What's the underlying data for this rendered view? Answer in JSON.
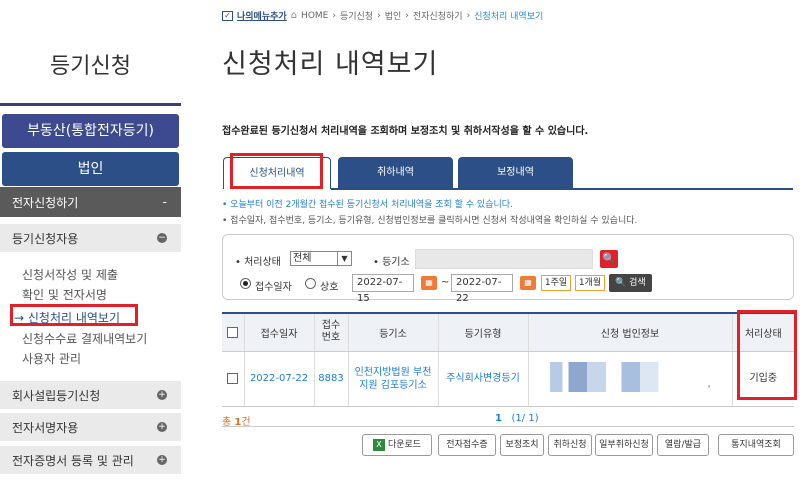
{
  "sidebar": {
    "title": "등기신청",
    "realestate_btn": "부동산(통합전자등기)",
    "corp_btn": "법인",
    "ecert": {
      "label": "전자신청하기",
      "ctl": "-"
    },
    "reguse": {
      "label": "등기신청자용"
    },
    "subitems": [
      "신청서작성 및 제출",
      "확인 및 전자서명",
      "→ 신청처리 내역보기",
      "신청수수료 결제내역보기",
      "사용자 관리"
    ],
    "sections": [
      "회사설립등기신청",
      "전자서명자용",
      "전자증명서 등록 및 관리"
    ]
  },
  "breadcrumb": {
    "mymenu": "나의메뉴추가",
    "items": [
      "HOME",
      "등기신청",
      "법인",
      "전자신청하기"
    ],
    "current": "신청처리 내역보기"
  },
  "page_title": "신청처리 내역보기",
  "description": "접수완료된 등기신청서 처리내역을 조회하며 보정조치 및 취하서작성을 할 수 있습니다.",
  "tabs": [
    "신청처리내역",
    "취하내역",
    "보정내역"
  ],
  "notes": {
    "line1": "오늘부터 이전 2개월간 접수된 등기신청서 처리내역을 조회 할 수 있습니다.",
    "line2": "접수일자, 접수번호, 등기소, 등기유형, 신청법인정보를 클릭하시면 신청서 작성내역을 확인하실 수 있습니다."
  },
  "search": {
    "status_label": "처리상태",
    "status_value": "전체",
    "office_label": "등기소",
    "radio1": "접수일자",
    "radio2": "상호",
    "date_from": "2022-07-15",
    "tilde": "~",
    "date_to": "2022-07-22",
    "week_btn": "1주일",
    "month_btn": "1개월",
    "search_btn": "검색"
  },
  "table": {
    "headers": [
      "접수일자",
      "접수\n번호",
      "등기소",
      "등기유형",
      "신청 법인정보",
      "처리상태"
    ],
    "row": {
      "date": "2022-07-22",
      "number": "8883",
      "office": "인천지방법원 부천지원 김포등기소",
      "type": "주식회사변경등기",
      "corp_suffix": "'",
      "status": "기입중"
    }
  },
  "total": {
    "prefix": "총 ",
    "count": "1",
    "suffix": "건"
  },
  "pager": {
    "page": "1",
    "info": "(1/ 1)"
  },
  "actions": [
    "다운로드",
    "전자접수증",
    "보정조치",
    "취하신청",
    "일부취하신청",
    "열람/발급",
    "통지내역조회"
  ]
}
